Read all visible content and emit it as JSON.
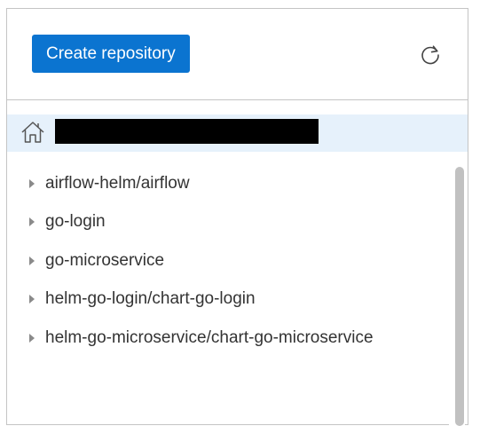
{
  "toolbar": {
    "create_button_label": "Create repository",
    "refresh_icon": "refresh-icon"
  },
  "path_bar": {
    "home_icon": "home-icon",
    "path_redacted": true
  },
  "tree": {
    "items": [
      {
        "label": "airflow-helm/airflow",
        "expanded": false
      },
      {
        "label": "go-login",
        "expanded": false
      },
      {
        "label": "go-microservice",
        "expanded": false
      },
      {
        "label": "helm-go-login/chart-go-login",
        "expanded": false
      },
      {
        "label": "helm-go-microservice/chart-go-microservice",
        "expanded": false
      }
    ]
  },
  "colors": {
    "primary": "#0b74d0",
    "path_bar_bg": "#e6f1fb",
    "border": "#c4c4c4"
  }
}
